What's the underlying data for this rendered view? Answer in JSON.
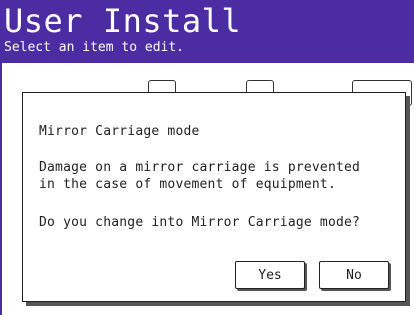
{
  "header": {
    "title": "User Install",
    "subtitle": "Select an item to edit."
  },
  "dialog": {
    "heading": "Mirror Carriage mode",
    "message_line1": "Damage on a mirror carriage is prevented",
    "message_line2": "in the case of movement of equipment.",
    "question": "Do you change into Mirror Carriage mode?",
    "yes_label": "Yes",
    "no_label": "No"
  },
  "colors": {
    "header_bg": "#4b2ca3",
    "header_text": "#ffffff",
    "dialog_text": "#222222"
  }
}
